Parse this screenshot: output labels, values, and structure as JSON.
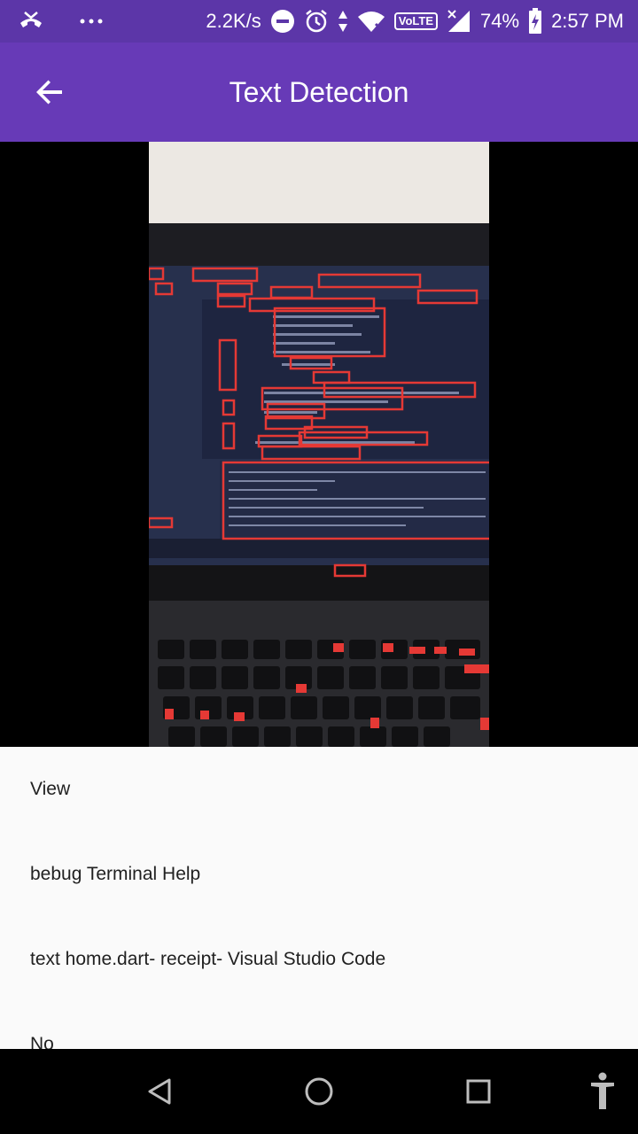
{
  "status_bar": {
    "net_speed": "2.2K/s",
    "network_type": "VoLTE",
    "battery": "74%",
    "time": "2:57 PM",
    "icons": [
      "missed-call-icon",
      "more-dots-icon",
      "dnd-icon",
      "alarm-icon",
      "data-arrows-icon",
      "wifi-icon",
      "volte-icon",
      "signal-icon",
      "battery-charging-icon"
    ]
  },
  "app_bar": {
    "title": "Text Detection",
    "back_icon": "arrow-back-icon"
  },
  "image": {
    "description_icon": "photo-with-detection-boxes",
    "box_color": "#e53935"
  },
  "results": [
    "View",
    "bebug Terminal Help",
    "text home.dart- receipt- Visual Studio Code",
    "No"
  ],
  "nav_bar": {
    "icons": [
      "back-triangle-icon",
      "home-circle-icon",
      "recents-square-icon",
      "accessibility-icon"
    ]
  },
  "colors": {
    "status_bar": "#5c36a8",
    "app_bar": "#673ab7",
    "list_bg": "#fafafa"
  }
}
